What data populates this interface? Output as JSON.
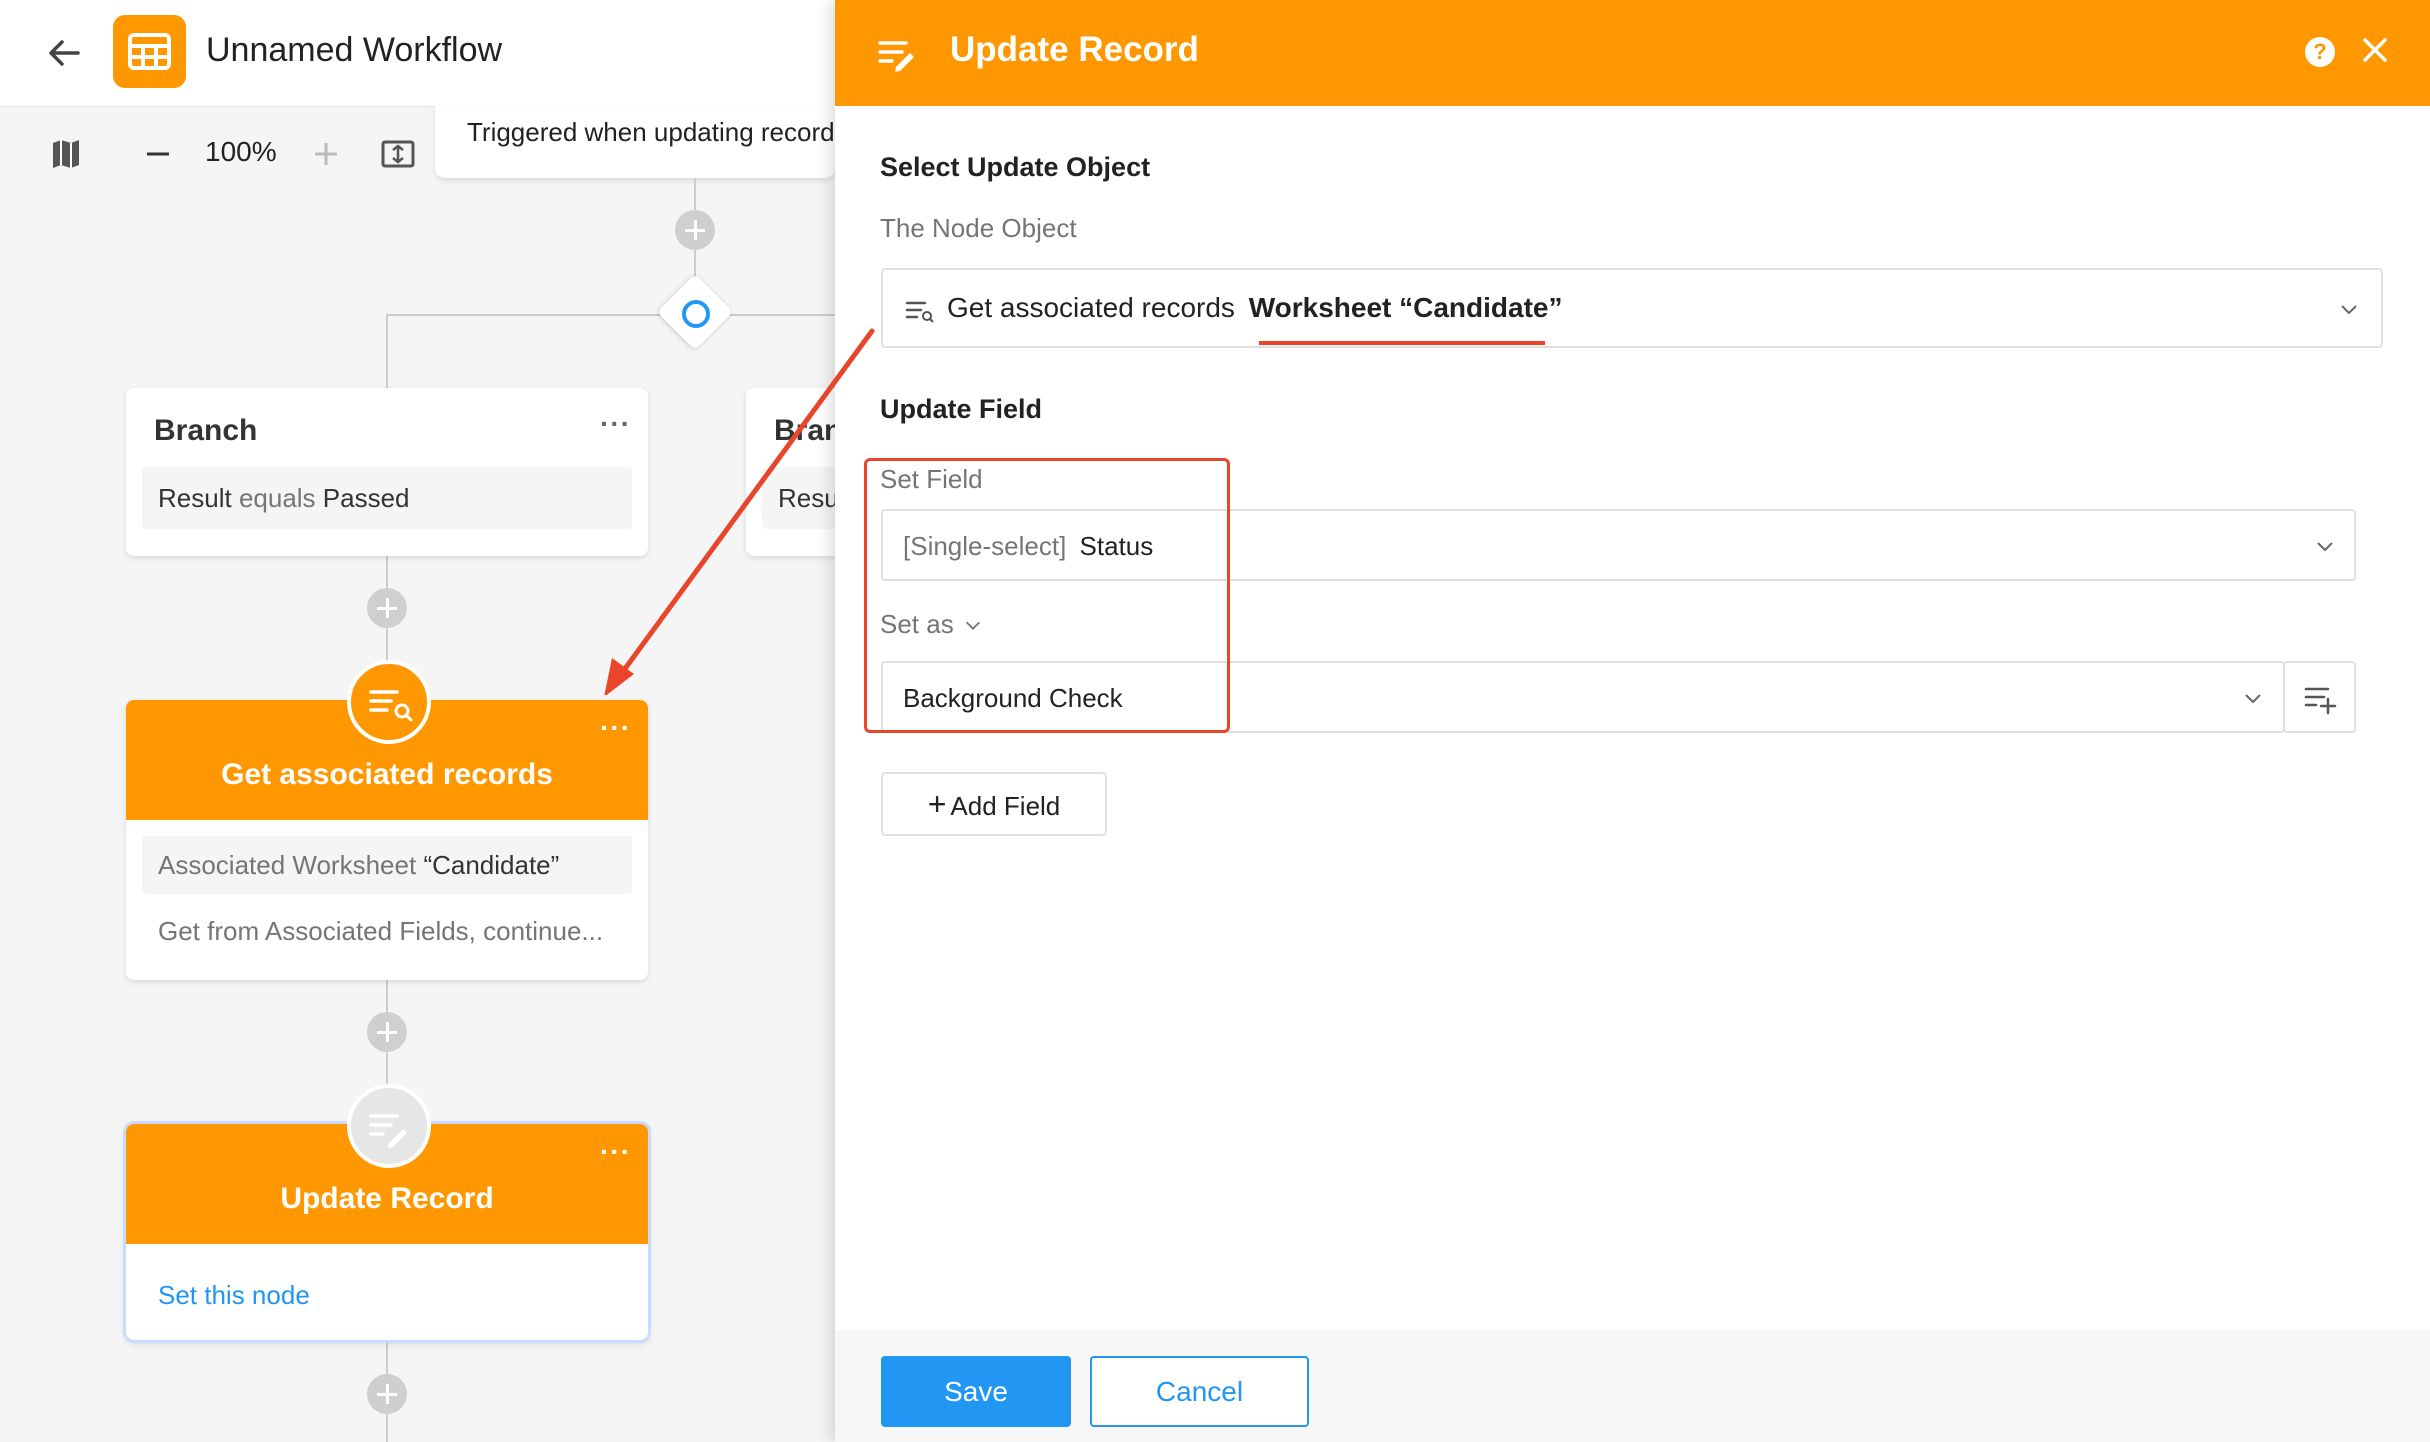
{
  "header": {
    "title": "Unnamed Workflow"
  },
  "toolbar": {
    "zoom": "100%"
  },
  "trigger": {
    "text": "Triggered when updating record"
  },
  "branch_left": {
    "title": "Branch",
    "menu": "···",
    "condition": {
      "field": "Result",
      "operator": "equals",
      "value": "Passed"
    }
  },
  "branch_right": {
    "title": "Bran",
    "condition_partial": "Resu"
  },
  "get_node": {
    "title": "Get associated records",
    "menu": "···",
    "worksheet_label": "Associated Worksheet",
    "worksheet_value": "“Candidate”",
    "description": "Get from Associated Fields, continue..."
  },
  "update_node": {
    "title": "Update Record",
    "menu": "···",
    "link": "Set this node"
  },
  "panel": {
    "title": "Update Record",
    "help": "?",
    "select_object": {
      "section_title": "Select Update Object",
      "label": "The Node Object",
      "value_prefix": "Get associated records",
      "value_bold": "Worksheet “Candidate”"
    },
    "update_field": {
      "section_title": "Update Field",
      "set_field_label": "Set Field",
      "field_type": "[Single-select]",
      "field_name": "Status",
      "set_as_label": "Set as",
      "set_as_value": "Background Check",
      "add_field": "Add Field"
    },
    "footer": {
      "save": "Save",
      "cancel": "Cancel"
    }
  },
  "colors": {
    "accent": "#ff9800",
    "primary": "#2196f3",
    "annotation": "#e8452b"
  },
  "icons": [
    "back-arrow-icon",
    "worksheet-grid-icon",
    "map-icon",
    "zoom-out-icon",
    "zoom-in-icon",
    "fit-screen-icon",
    "plus-icon",
    "branch-diamond-icon",
    "get-records-icon",
    "update-record-icon",
    "help-icon",
    "close-icon",
    "chevron-down-icon",
    "list-add-icon"
  ]
}
